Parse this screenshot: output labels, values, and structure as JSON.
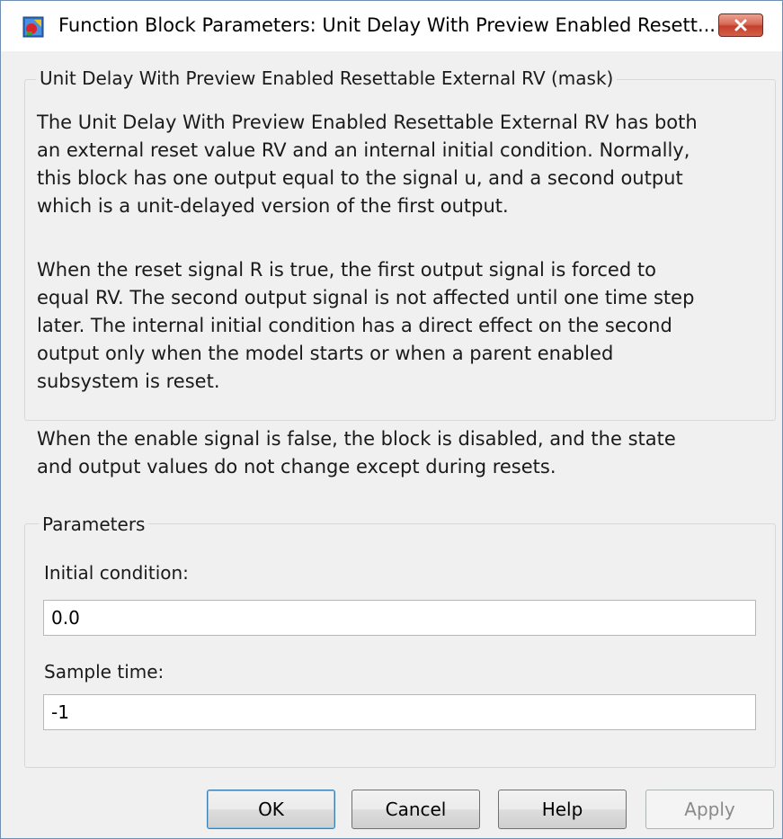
{
  "window": {
    "title": "Function Block Parameters: Unit Delay With Preview Enabled Resett...",
    "icon": "simulink-block-icon",
    "close_icon": "close-icon"
  },
  "mask_group": {
    "legend": "Unit Delay With Preview Enabled Resettable External RV (mask)",
    "description_1": "The Unit Delay With Preview Enabled Resettable External RV has both\nan external reset value RV and an internal initial condition. Normally,\nthis block has one output equal to the signal u, and a second output\nwhich is a unit-delayed version of the first output.",
    "description_2": "When the reset signal R is true, the first output signal is forced to\nequal RV. The second output signal is not affected until one time step\nlater. The internal initial condition has a direct effect on the second\noutput only when the model starts or when a parent enabled\nsubsystem is reset.",
    "description_3": "When the enable signal is false, the block is disabled, and the state\nand output values do not change except during resets."
  },
  "parameters": {
    "legend": "Parameters",
    "initial_condition_label": "Initial condition:",
    "initial_condition_value": "0.0",
    "sample_time_label": "Sample time:",
    "sample_time_value": "-1"
  },
  "buttons": {
    "ok": "OK",
    "cancel": "Cancel",
    "help": "Help",
    "apply": "Apply"
  }
}
